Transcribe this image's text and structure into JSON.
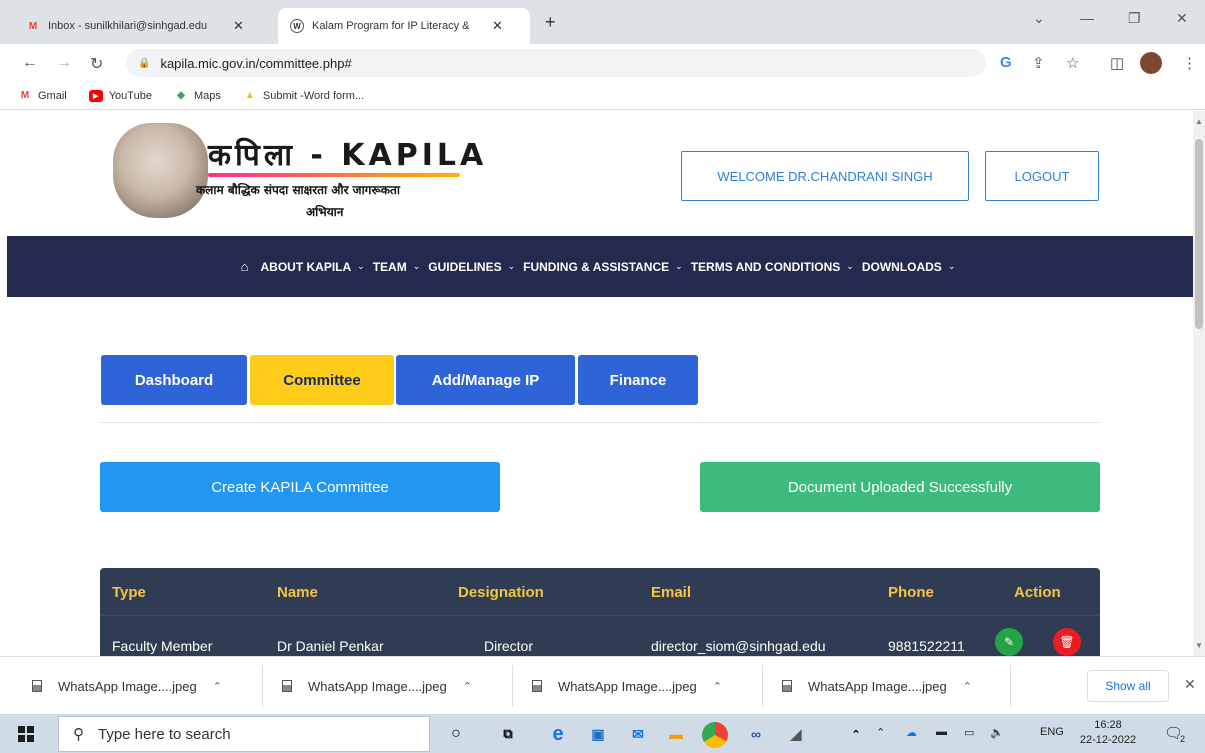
{
  "browser": {
    "tabs": [
      {
        "label": "Inbox - sunilkhilari@sinhgad.edu",
        "icon": "gmail-icon",
        "active": false
      },
      {
        "label": "Kalam Program for IP Literacy &",
        "icon": "site-icon",
        "active": true
      }
    ],
    "new_tab": "+",
    "url": "kapila.mic.gov.in/committee.php#",
    "bookmarks": [
      "Gmail",
      "YouTube",
      "Maps",
      "Submit -Word form..."
    ]
  },
  "header": {
    "logo_title": "कपिला - KAPILA",
    "logo_subtitle_line1": "कलाम बौद्धिक संपदा साक्षरता और जागरूकता",
    "logo_subtitle_line2": "अभियान",
    "welcome_label": "WELCOME DR.CHANDRANI SINGH",
    "logout_label": "LOGOUT"
  },
  "nav": {
    "items": [
      "ABOUT KAPILA",
      "TEAM",
      "GUIDELINES",
      "FUNDING & ASSISTANCE",
      "TERMS AND CONDITIONS",
      "DOWNLOADS"
    ]
  },
  "page_tabs": [
    "Dashboard",
    "Committee",
    "Add/Manage IP",
    "Finance"
  ],
  "active_tab": "Committee",
  "create_button": "Create KAPILA Committee",
  "alert_message": "Document Uploaded Successfully",
  "table": {
    "headers": [
      "Type",
      "Name",
      "Designation",
      "Email",
      "Phone",
      "Action"
    ],
    "rows": [
      {
        "type": "Faculty Member",
        "name": "Dr Daniel Penkar",
        "designation": "Director",
        "email": "director_siom@sinhgad.edu",
        "phone": "9881522211"
      }
    ]
  },
  "downloads": {
    "items": [
      "WhatsApp Image....jpeg",
      "WhatsApp Image....jpeg",
      "WhatsApp Image....jpeg",
      "WhatsApp Image....jpeg"
    ],
    "show_all": "Show all"
  },
  "taskbar": {
    "search_placeholder": "Type here to search",
    "language": "ENG",
    "time": "16:28",
    "date": "22-12-2022",
    "notification_count": "2"
  },
  "colors": {
    "nav_bg": "#232a4e",
    "tab_blue": "#2f63d8",
    "tab_active": "#ffcc1a",
    "create_btn": "#2196f3",
    "alert_green": "#3dba7e",
    "table_bg": "#303c54",
    "table_header_text": "#f4c542"
  }
}
